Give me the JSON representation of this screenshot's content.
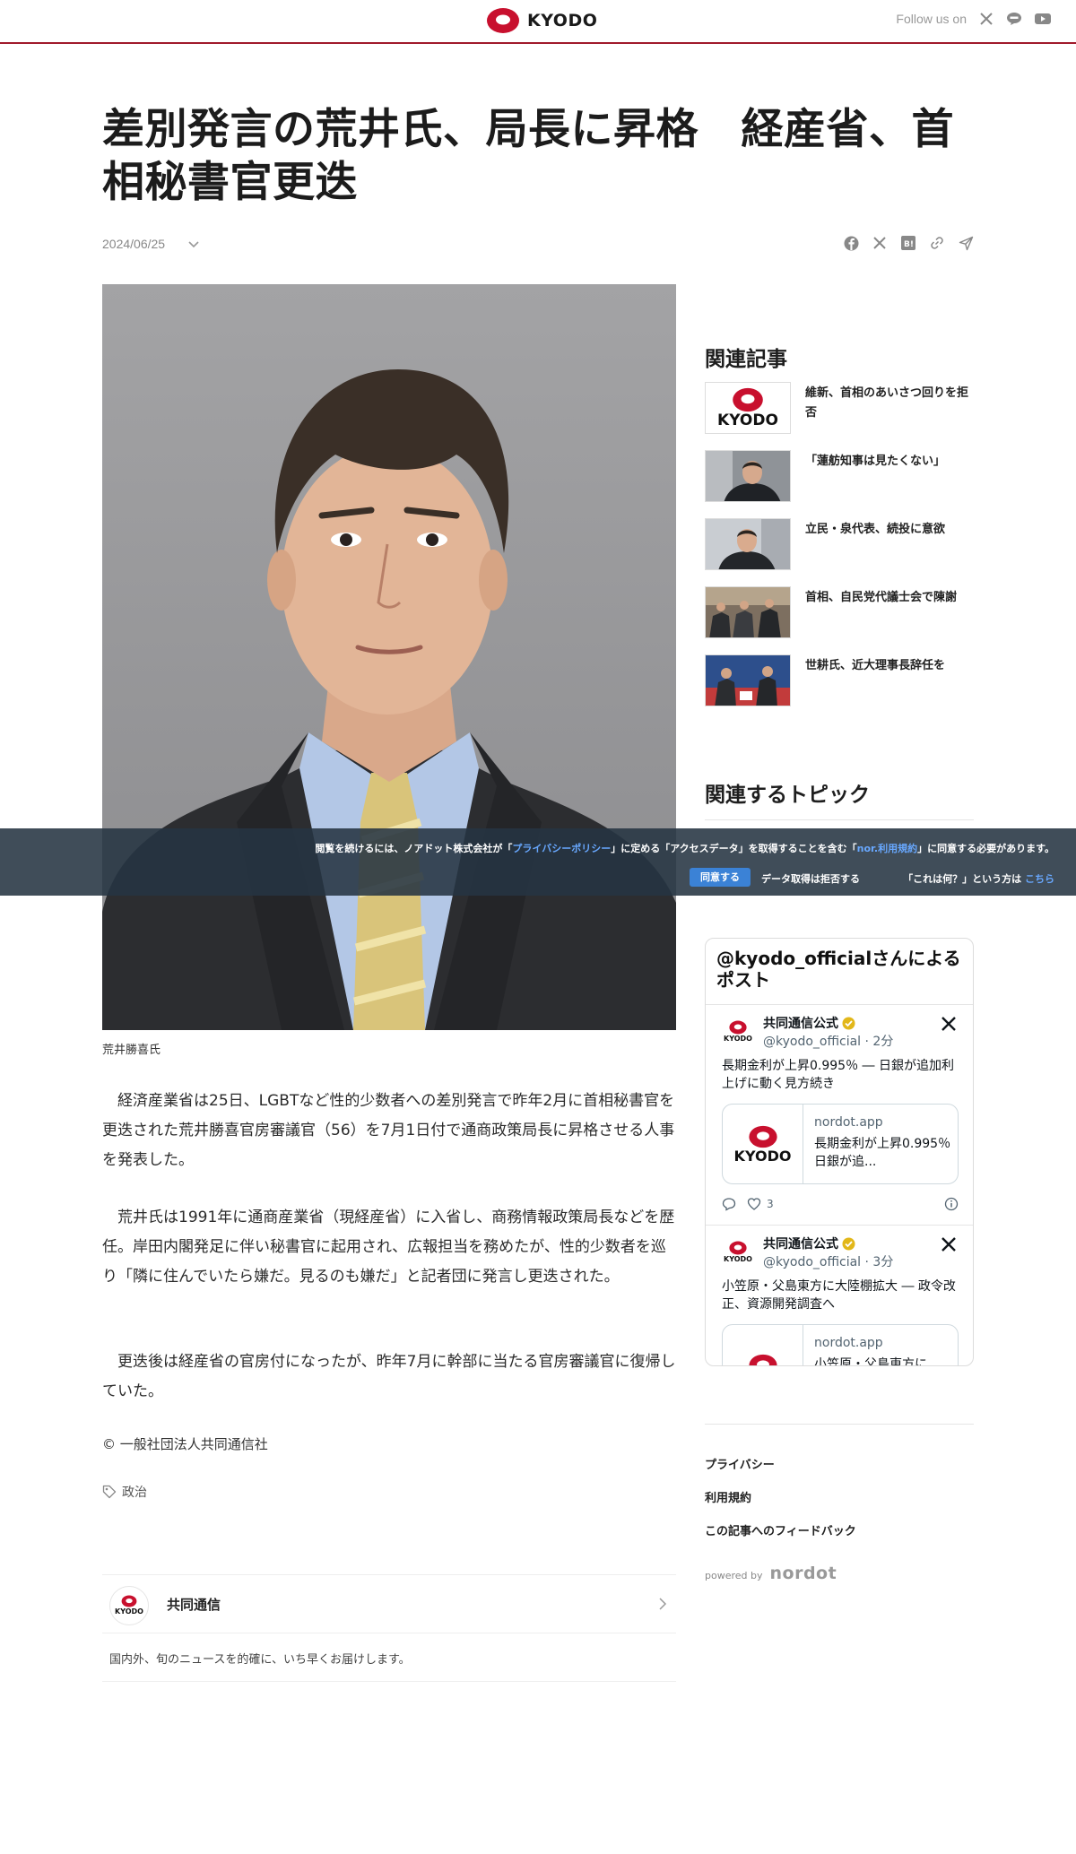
{
  "header": {
    "brand_name": "KYODO",
    "follow_label": "Follow us on",
    "social_icons": [
      "x-icon",
      "line-icon",
      "youtube-icon"
    ]
  },
  "article": {
    "title": "差別発言の荒井氏、局長に昇格　経産省、首相秘書官更迭",
    "date": "2024/06/25",
    "share_icons": [
      "facebook-icon",
      "x-icon",
      "hatena-bookmark-icon",
      "link-icon",
      "send-icon"
    ],
    "photo_caption": "荒井勝喜氏",
    "paragraphs": [
      "　経済産業省は25日、LGBTなど性的少数者への差別発言で昨年2月に首相秘書官を更迭された荒井勝喜官房審議官（56）を7月1日付で通商政策局長に昇格させる人事を発表した。",
      "　荒井氏は1991年に通商産業省（現経産省）に入省し、商務情報政策局長などを歴任。岸田内閣発足に伴い秘書官に起用され、広報担当を務めたが、性的少数者を巡り「隣に住んでいたら嫌だ。見るのも嫌だ」と記者団に発言し更迭された。",
      "　更迭後は経産省の官房付になったが、昨年7月に幹部に当たる官房審議官に復帰していた。"
    ],
    "copyright": "© 一般社団法人共同通信社",
    "tag": "政治"
  },
  "publisher": {
    "logo_text": "KYODO",
    "name": "共同通信",
    "description": "国内外、旬のニュースを的確に、いち早くお届けします。"
  },
  "sidebar": {
    "related_heading": "関連記事",
    "related": [
      {
        "title": "維新、首相のあいさつ回りを拒否",
        "thumb_logo": "KYODO"
      },
      {
        "title": "「蓮舫知事は見たくない」"
      },
      {
        "title": "立民・泉代表、続投に意欲"
      },
      {
        "title": "首相、自民党代議士会で陳謝"
      },
      {
        "title": "世耕氏、近大理事長辞任を"
      }
    ],
    "topics_heading": "関連するトピック",
    "embed": {
      "heading": "@kyodo_officialさんによるポスト",
      "tweets": [
        {
          "author": "共同通信公式",
          "handle": "@kyodo_official · 2分",
          "text": "長期金利が上昇0.995％ ― 日銀が追加利上げに動く見方続き",
          "card_domain": "nordot.app",
          "card_title": "長期金利が上昇0.995％　日銀が追...",
          "likes": "3"
        },
        {
          "author": "共同通信公式",
          "handle": "@kyodo_official · 3分",
          "text": "小笠原・父島東方に大陸棚拡大 ― 政令改正、資源開発調査へ",
          "card_domain": "nordot.app",
          "card_title": "小笠原・父島東方に..."
        }
      ],
      "logo_text": "KYODO"
    },
    "footer_links": [
      "プライバシー",
      "利用規約",
      "この記事へのフィードバック"
    ],
    "powered_label": "powered by",
    "powered_brand": "nordot"
  },
  "consent": {
    "text_before": "閲覧を続けるには、ノアドット株式会社が「",
    "privacy_link": "プライバシーポリシー",
    "text_middle": "」に定める「アクセスデータ」を取得することを含む「",
    "terms_link": "nor.利用規約",
    "text_after": "」に同意する必要があります。",
    "agree_label": "同意する",
    "refuse_label": "データ取得は拒否する",
    "what_before": "「これは何？」という方は",
    "what_link": "こちら"
  },
  "colors": {
    "brand_red": "#c8102e",
    "header_border": "#a0192b",
    "consent_bg": "#263442",
    "consent_link": "#68a8ff",
    "agree_button": "#3b82d6"
  }
}
